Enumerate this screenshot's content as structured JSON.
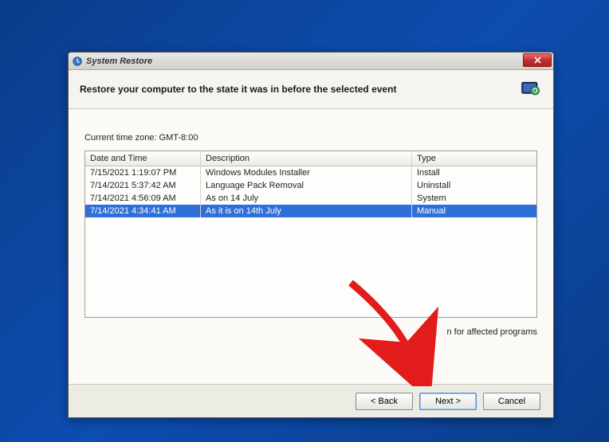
{
  "window": {
    "title": "System Restore"
  },
  "header": {
    "heading": "Restore your computer to the state it was in before the selected event"
  },
  "timezone_label": "Current time zone: GMT-8:00",
  "columns": {
    "datetime": "Date and Time",
    "description": "Description",
    "type": "Type"
  },
  "rows": [
    {
      "datetime": "7/15/2021 1:19:07 PM",
      "description": "Windows Modules Installer",
      "type": "Install",
      "selected": false
    },
    {
      "datetime": "7/14/2021 5:37:42 AM",
      "description": "Language Pack Removal",
      "type": "Uninstall",
      "selected": false
    },
    {
      "datetime": "7/14/2021 4:56:09 AM",
      "description": "As on 14 July",
      "type": "System",
      "selected": false
    },
    {
      "datetime": "7/14/2021 4:34:41 AM",
      "description": "As it is on 14th July",
      "type": "Manual",
      "selected": true
    }
  ],
  "scan_link": "n for affected programs",
  "buttons": {
    "back": "< Back",
    "next": "Next >",
    "cancel": "Cancel"
  }
}
